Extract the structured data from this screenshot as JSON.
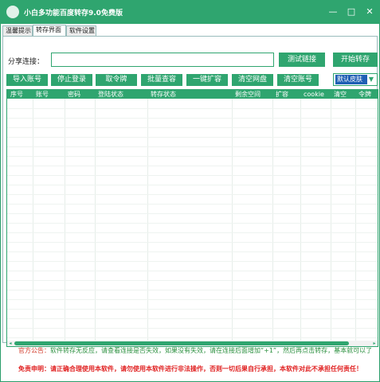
{
  "window": {
    "title": "小白多功能百度转存9.0免费版",
    "minimize_glyph": "—",
    "maximize_glyph": "□",
    "close_glyph": "✕",
    "icon": "app-logo-icon"
  },
  "tabs": [
    {
      "label": "温馨提示",
      "active": false
    },
    {
      "label": "转存界面",
      "active": true
    },
    {
      "label": "软件设置",
      "active": false
    }
  ],
  "share": {
    "label": "分享连接：",
    "value": "",
    "placeholder": ""
  },
  "buttons": {
    "test_link": "测试链接",
    "start_transfer": "开始转存",
    "import_accounts": "导入账号",
    "stop_login": "停止登录",
    "get_token": "取令牌",
    "batch_check": "批量查容",
    "one_click_expand": "一键扩容",
    "clear_disk": "清空网盘",
    "clear_accounts": "清空账号"
  },
  "skin_select": {
    "selected": "默认皮肤",
    "arrow_icon": "chevron-down-icon",
    "arrow_glyph": "▼"
  },
  "grid": {
    "columns": [
      "序号",
      "账号",
      "密码",
      "登陆状态",
      "转存状态",
      "剩余空间",
      "扩容",
      "cookie",
      "清空",
      "令牌"
    ],
    "rows": []
  },
  "scroll": {
    "left_glyph": "◂",
    "right_glyph": "▸"
  },
  "footer": {
    "notice_label": "官方公告：",
    "notice_text": "软件转存无反应，请查看连接是否失效，如果没有失效，请在连接后面增加“+1”，然后再点击转存，基本就可以了",
    "disclaimer": "免责申明：请正确合理使用本软件，请勿使用本软件进行非法操作，否则一切后果自行承担，本软件对此不承担任何责任！"
  },
  "colors": {
    "accent": "#2fa56f",
    "disclaimer": "#e02020",
    "notice": "#2a8f3e"
  }
}
